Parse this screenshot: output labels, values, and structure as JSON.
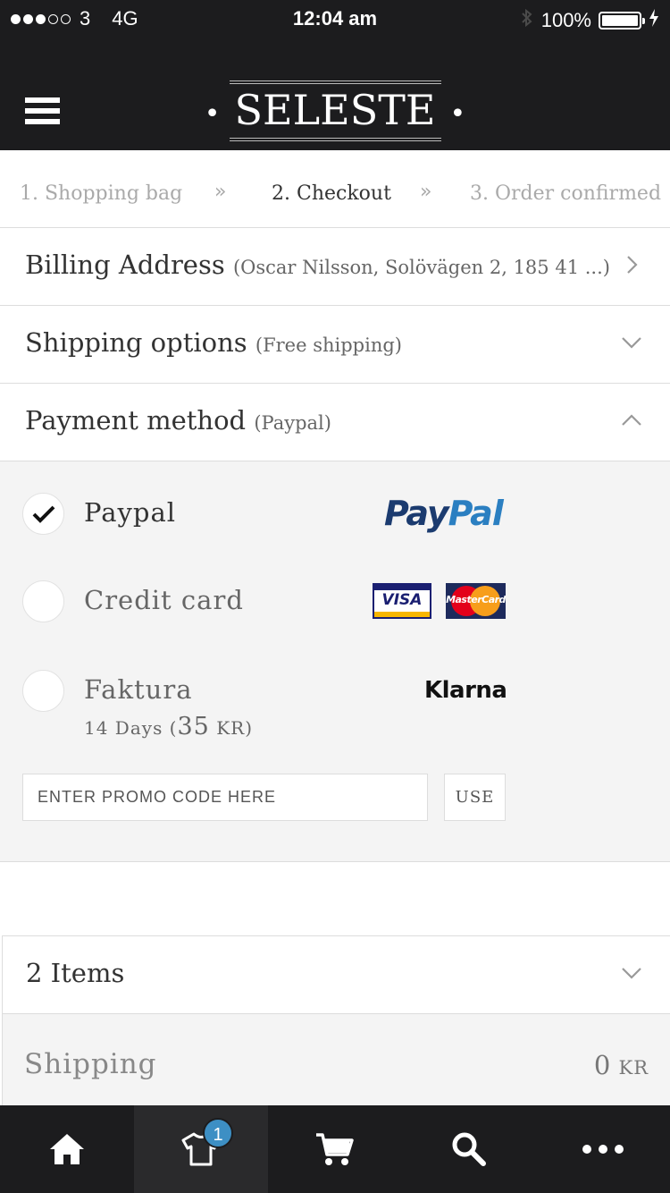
{
  "status_bar": {
    "carrier": "3",
    "network": "4G",
    "time": "12:04 am",
    "battery": "100%"
  },
  "header": {
    "brand": "SELESTE"
  },
  "steps": [
    {
      "label": "1. Shopping bag",
      "state": "done"
    },
    {
      "label": "2. Checkout",
      "state": "active"
    },
    {
      "label": "3. Order confirmed",
      "state": "pending"
    }
  ],
  "sections": {
    "billing": {
      "title": "Billing Address",
      "summary": "(Oscar Nilsson, Solövägen 2, 185 41 ...)"
    },
    "shipping": {
      "title": "Shipping options",
      "summary": "(Free shipping)"
    },
    "payment": {
      "title": "Payment method",
      "summary": "(Paypal)"
    }
  },
  "payment_options": [
    {
      "label": "Paypal",
      "checked": true,
      "logo": "paypal-logo"
    },
    {
      "label": "Credit card",
      "checked": false,
      "logo": "visa-mastercard-logos"
    },
    {
      "label": "Faktura",
      "checked": false,
      "logo": "klarna-logo",
      "sub_prefix": "14 Days (",
      "sub_amount": "35",
      "sub_currency": "KR",
      "sub_suffix": ")"
    }
  ],
  "logos": {
    "paypal_a": "Pay",
    "paypal_b": "Pal",
    "visa": "VISA",
    "mastercard": "MasterCard",
    "klarna": "Klarna"
  },
  "promo": {
    "placeholder": "ENTER PROMO CODE HERE",
    "button": "USE"
  },
  "summary": {
    "items_label": "2 Items",
    "shipping_label": "Shipping",
    "shipping_amount": "0",
    "shipping_currency": "KR"
  },
  "tabbar": {
    "items": [
      "home-icon",
      "shirt-icon",
      "cart-icon",
      "search-icon",
      "more-icon"
    ],
    "cart_count": "1",
    "active": "shirt-icon"
  },
  "colors": {
    "header_bg": "#1c1c1e",
    "panel_bg": "#f4f4f4",
    "badge": "#3d8fc4"
  }
}
